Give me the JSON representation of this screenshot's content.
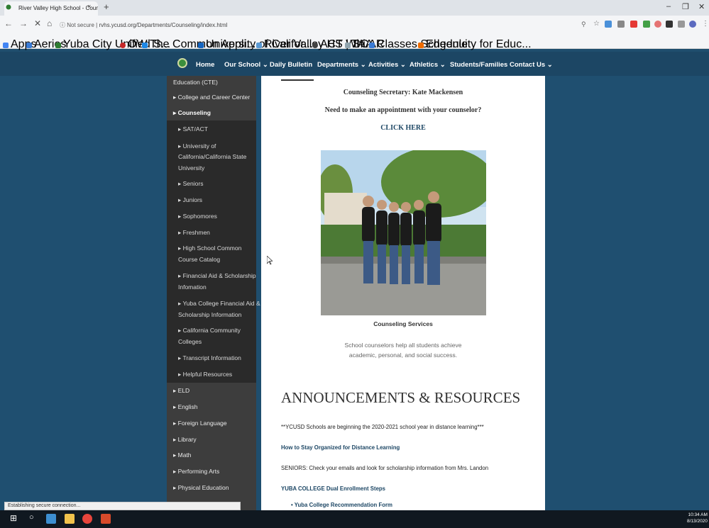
{
  "browser": {
    "tab_title": "River Valley High School - Couns",
    "tab_close": "×",
    "new_tab": "+",
    "window_controls": [
      "–",
      "❐",
      "✕"
    ],
    "nav": {
      "back": "←",
      "forward": "→",
      "reload": "✕",
      "home": "⌂"
    },
    "security": "Not secure",
    "url": "rvhs.ycusd.org/Departments/Counseling/index.html",
    "bookmarks": [
      "Apps",
      "Aeries",
      "Yuba City Unified S...",
      "OW",
      "The Common Appli...",
      "University of Califor...",
      "River Valley HS Whi...",
      "ACT | TAA",
      "SCAR",
      "Classes Schedule",
      "Edgenuity for Educ..."
    ],
    "status_text": "Establishing secure connection..."
  },
  "site_nav": [
    "Home",
    "Our School",
    "Daily Bulletin",
    "Departments",
    "Activities",
    "Athletics",
    "Students/Families",
    "Contact Us"
  ],
  "sidebar": {
    "top_items": [
      "Education (CTE)",
      "College and Career Center",
      "Counseling"
    ],
    "sub_items": [
      "SAT/ACT",
      "University of",
      "California/California State",
      "University",
      "Seniors",
      "Juniors",
      "Sophomores",
      "Freshmen",
      "High School Common",
      "Course Catalog",
      "Financial Aid & Scholarship",
      "Infomation",
      "Yuba College Financial Aid &",
      "Scholarship Information",
      "California Community",
      "Colleges",
      "Transcript Information",
      "Helpful Resources"
    ],
    "bottom_items": [
      "ELD",
      "English",
      "Foreign Language",
      "Library",
      "Math",
      "Performing Arts",
      "Physical Education"
    ]
  },
  "content": {
    "secretary": "Counseling Secretary: Kate Mackensen",
    "appointment": "Need to make an appointment with your counselor?",
    "click_here": "CLICK HERE",
    "photo_caption": "Counseling Services",
    "desc_line1": "School counselors help all students achieve",
    "desc_line2": "academic, personal, and social success.",
    "announcements_title": "ANNOUNCEMENTS & RESOURCES",
    "announcements": [
      "**YCUSD Schools are beginning the 2020-2021 school year in distance learning***",
      "How to Stay Organized for Distance Learning",
      "SENIORS: Check your emails and look for scholarship information from Mrs. Landon",
      "YUBA COLLEGE Dual Enrollment Steps",
      "Yuba College Recommendation Form"
    ]
  },
  "taskbar": {
    "time": "10:34 AM",
    "date": "8/13/2020"
  }
}
